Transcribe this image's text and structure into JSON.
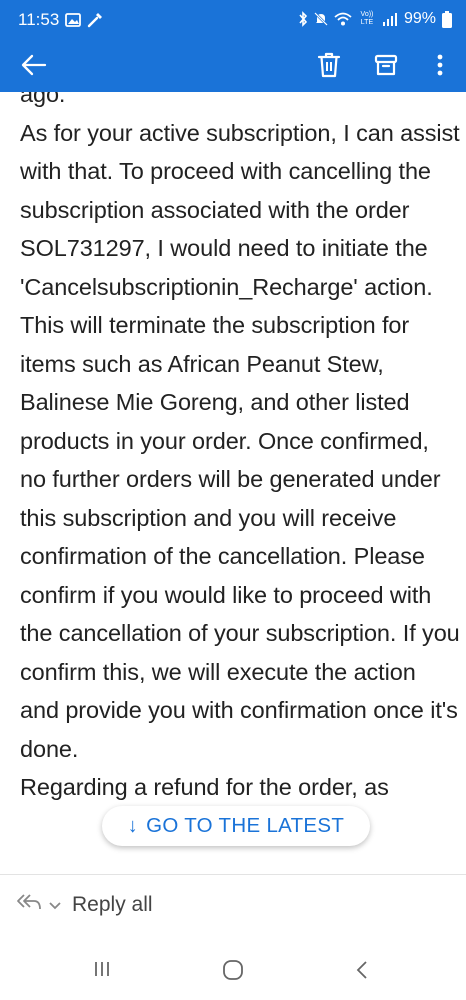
{
  "status_bar": {
    "time": "11:53",
    "carrier_label": "Vo)) LTE",
    "battery": "99%"
  },
  "app_bar": {
    "icons": [
      "back-arrow-icon",
      "trash-icon",
      "archive-icon",
      "more-vert-icon"
    ]
  },
  "message": {
    "body": "ago.\nAs for your active subscription, I can assist with that. To proceed with cancelling the subscription associated with the order SOL731297, I would need to initiate the 'Cancelsubscriptionin_Recharge' action. This will terminate the subscription for items such as African Peanut Stew, Balinese Mie Goreng, and other listed products in your order. Once confirmed, no further orders will be generated under this subscription and you will receive confirmation of the cancellation. Please confirm if you would like to proceed with the cancellation of your subscription. If you confirm this, we will execute the action and provide you with confirmation once it's done.\nRegarding a refund for the order, as"
  },
  "go_to_latest": {
    "label": "GO TO THE LATEST"
  },
  "reply_bar": {
    "label": "Reply all"
  },
  "nav_bar": {
    "icons": [
      "recents-icon",
      "home-icon",
      "back-icon"
    ]
  }
}
